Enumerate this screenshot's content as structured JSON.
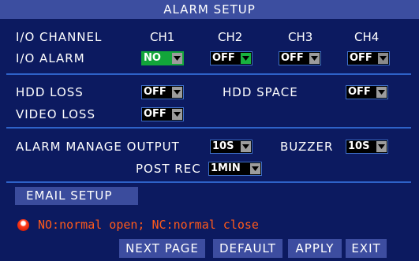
{
  "title": "ALARM SETUP",
  "io": {
    "channel_label": "I/O CHANNEL",
    "alarm_label": "I/O ALARM",
    "channels": [
      "CH1",
      "CH2",
      "CH3",
      "CH4"
    ],
    "alarm_values": [
      "NO",
      "OFF",
      "OFF",
      "OFF"
    ]
  },
  "hdd": {
    "loss_label": "HDD LOSS",
    "loss_value": "OFF",
    "space_label": "HDD SPACE",
    "space_value": "OFF"
  },
  "video": {
    "loss_label": "VIDEO LOSS",
    "loss_value": "OFF"
  },
  "alarm_manage": {
    "output_label": "ALARM MANAGE OUTPUT",
    "output_value": "10S",
    "buzzer_label": "BUZZER",
    "buzzer_value": "10S",
    "post_rec_label": "POST REC",
    "post_rec_value": "1MIN"
  },
  "email": {
    "tab_label": "EMAIL SETUP"
  },
  "note": {
    "icon": "red-dot-icon",
    "text": "NO:normal open;  NC:normal close"
  },
  "buttons": {
    "next_page": "NEXT PAGE",
    "default": "DEFAULT",
    "apply": "APPLY",
    "exit": "EXIT"
  },
  "colors": {
    "background": "#0c1a60",
    "title_bar": "#3c4ea0",
    "divider": "#2e62c8",
    "active_select": "#12a53a",
    "note_text": "#ff5a1a"
  }
}
